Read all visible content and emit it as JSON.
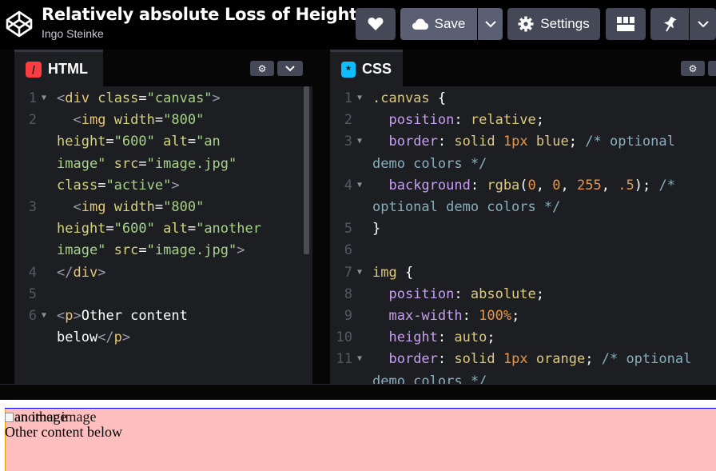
{
  "header": {
    "title": "Relatively absolute Loss of Height",
    "author": "Ingo Steinke",
    "buttons": {
      "save": "Save",
      "settings": "Settings"
    }
  },
  "editors": {
    "html": {
      "label": "HTML",
      "lines": [
        {
          "n": "1",
          "fold": true
        },
        {
          "n": "2",
          "fold": false
        },
        {
          "n": "",
          "fold": false
        },
        {
          "n": "",
          "fold": false
        },
        {
          "n": "",
          "fold": false
        },
        {
          "n": "3",
          "fold": false
        },
        {
          "n": "",
          "fold": false
        },
        {
          "n": "",
          "fold": false
        },
        {
          "n": "4",
          "fold": false
        },
        {
          "n": "5",
          "fold": false
        },
        {
          "n": "6",
          "fold": true
        },
        {
          "n": "",
          "fold": false
        }
      ]
    },
    "css": {
      "label": "CSS",
      "lines": [
        {
          "n": "1",
          "fold": true
        },
        {
          "n": "2",
          "fold": false
        },
        {
          "n": "3",
          "fold": true
        },
        {
          "n": "",
          "fold": false
        },
        {
          "n": "4",
          "fold": true
        },
        {
          "n": "",
          "fold": false
        },
        {
          "n": "5",
          "fold": false
        },
        {
          "n": "6",
          "fold": false
        },
        {
          "n": "7",
          "fold": true
        },
        {
          "n": "8",
          "fold": false
        },
        {
          "n": "9",
          "fold": false
        },
        {
          "n": "10",
          "fold": false
        },
        {
          "n": "11",
          "fold": true
        },
        {
          "n": "",
          "fold": false
        }
      ]
    }
  },
  "result": {
    "img_alt_1": "an image",
    "img_alt_2": "another image",
    "paragraph": "Other content below"
  },
  "icons": [
    "codepen-logo-icon",
    "pencil-icon",
    "heart-icon",
    "cloud-icon",
    "chevron-down-icon",
    "gear-icon",
    "layout-icon",
    "pin-icon"
  ]
}
